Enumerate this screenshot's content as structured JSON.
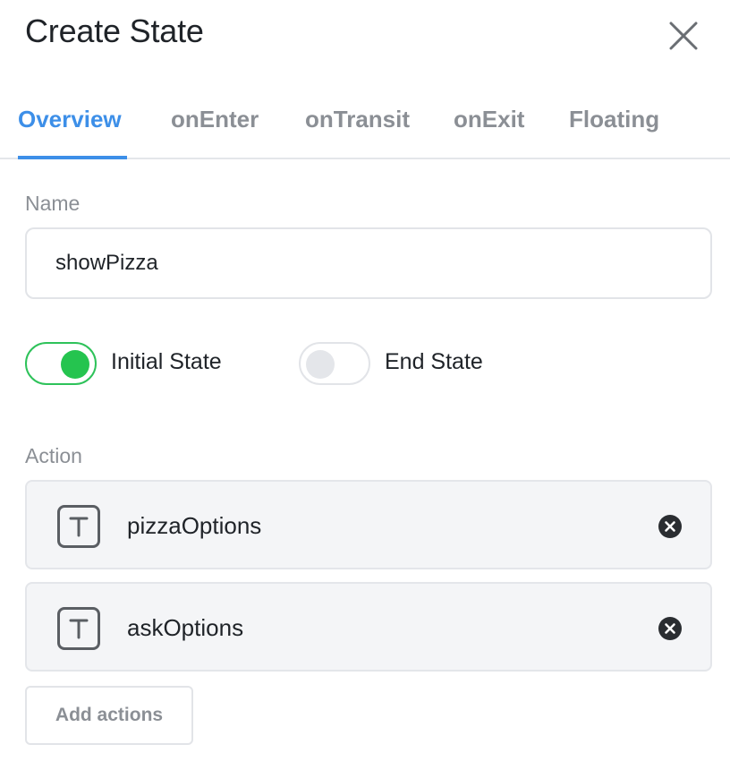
{
  "dialog": {
    "title": "Create State",
    "close_icon": "close-icon"
  },
  "tabs": [
    {
      "label": "Overview",
      "active": true
    },
    {
      "label": "onEnter",
      "active": false
    },
    {
      "label": "onTransit",
      "active": false
    },
    {
      "label": "onExit",
      "active": false
    },
    {
      "label": "Floating",
      "active": false
    }
  ],
  "name_field": {
    "label": "Name",
    "value": "showPizza"
  },
  "toggles": {
    "initial_state": {
      "label": "Initial State",
      "checked": true
    },
    "end_state": {
      "label": "End State",
      "checked": false
    }
  },
  "actions": {
    "label": "Action",
    "items": [
      {
        "name": "pizzaOptions",
        "icon": "text-type-icon"
      },
      {
        "name": "askOptions",
        "icon": "text-type-icon"
      }
    ],
    "add_label": "Add actions"
  },
  "colors": {
    "accent": "#3d8fe8",
    "toggle_on": "#25c44f",
    "muted_text": "#8b8f95",
    "card_bg": "#f4f5f7"
  }
}
